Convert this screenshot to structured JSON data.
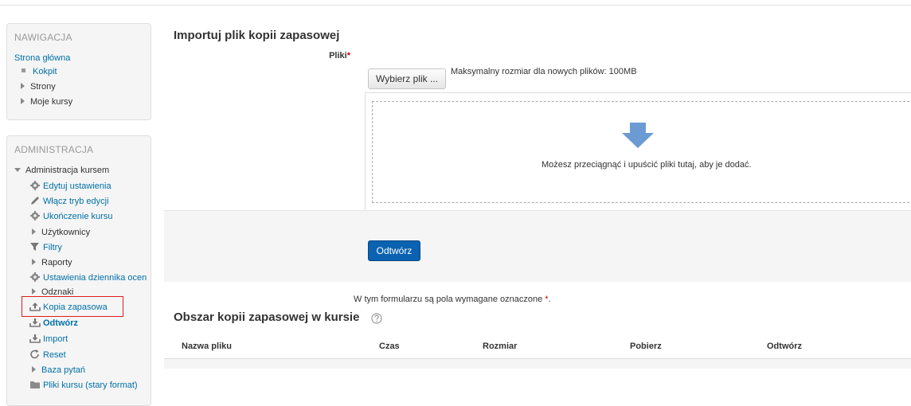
{
  "sidebar": {
    "nav": {
      "title": "NAWIGACJA",
      "home": "Strona główna",
      "items": [
        {
          "label": "Kokpit"
        },
        {
          "label": "Strony"
        },
        {
          "label": "Moje kursy"
        }
      ]
    },
    "admin": {
      "title": "ADMINISTRACJA",
      "course_admin": "Administracja kursem",
      "items": [
        {
          "label": "Edytuj ustawienia",
          "icon": "gear-icon"
        },
        {
          "label": "Włącz tryb edycji",
          "icon": "pencil-icon"
        },
        {
          "label": "Ukończenie kursu",
          "icon": "gear-icon"
        },
        {
          "label": "Użytkownicy",
          "icon": "chevron-right-icon"
        },
        {
          "label": "Filtry",
          "icon": "filter-icon"
        },
        {
          "label": "Raporty",
          "icon": "chevron-right-icon"
        },
        {
          "label": "Ustawienia dziennika ocen",
          "icon": "gear-icon"
        },
        {
          "label": "Odznaki",
          "icon": "chevron-right-icon"
        },
        {
          "label": "Kopia zapasowa",
          "icon": "backup-icon"
        },
        {
          "label": "Odtwórz",
          "icon": "restore-icon"
        },
        {
          "label": "Import",
          "icon": "import-icon"
        },
        {
          "label": "Reset",
          "icon": "reset-icon"
        },
        {
          "label": "Baza pytań",
          "icon": "chevron-right-icon"
        },
        {
          "label": "Pliki kursu (stary format)",
          "icon": "folder-icon"
        }
      ]
    }
  },
  "main": {
    "import_heading": "Importuj plik kopii zapasowej",
    "files_label": "Pliki",
    "required_mark": "*",
    "choose_file_button": "Wybierz plik ...",
    "max_size": "Maksymalny rozmiar dla nowych plików: 100MB",
    "dropzone_text": "Możesz przeciągnąć i upuścić pliki tutaj, aby je dodać.",
    "restore_button": "Odtwórz",
    "required_note": "W tym formularzu są pola wymagane oznaczone",
    "required_note_mark": "*",
    "required_note_end": ".",
    "backup_area_heading": "Obszar kopii zapasowej w kursie",
    "table_columns": [
      "Nazwa pliku",
      "Czas",
      "Rozmiar",
      "Pobierz",
      "Odtwórz"
    ]
  },
  "colors": {
    "link": "#0070a8",
    "primary_button": "#0a62b0",
    "highlight_box": "#e01b1b",
    "dropzone_arrow": "#6c9bd3"
  }
}
